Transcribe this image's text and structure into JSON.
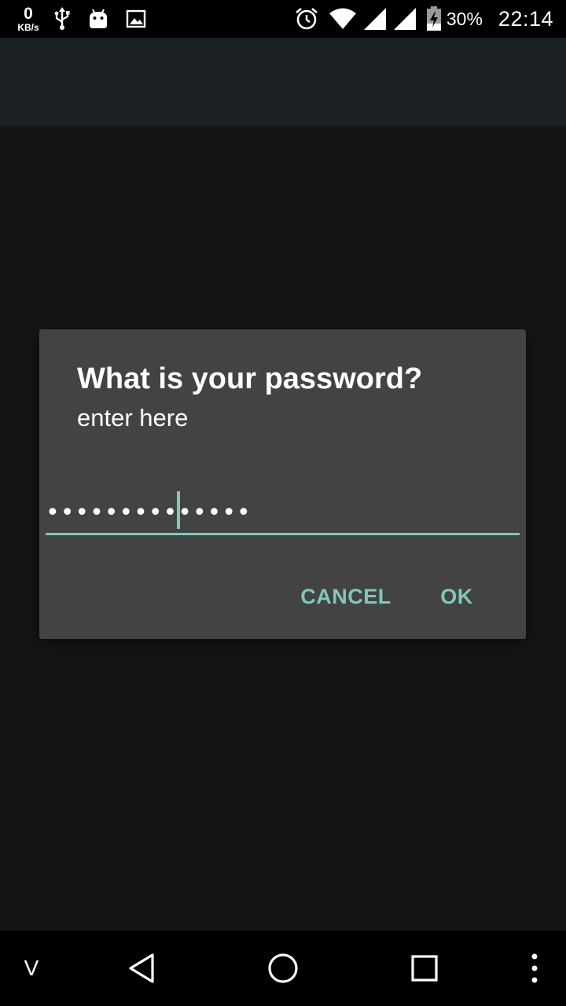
{
  "status_bar": {
    "net_speed_value": "0",
    "net_speed_unit": "KB/s",
    "left_icons": [
      "usb-icon",
      "android-debug-icon",
      "image-icon"
    ],
    "right_icons": [
      "alarm-icon",
      "wifi-icon",
      "cell-signal-icon",
      "cell-signal-icon",
      "battery-charging-icon"
    ],
    "battery_percent": "30%",
    "time": "22:14"
  },
  "dialog": {
    "title": "What is your password?",
    "message": "enter here",
    "password_value": "••••••••••••••",
    "cancel_label": "CANCEL",
    "ok_label": "OK"
  },
  "nav_bar": {
    "extra_label": "V",
    "icons": [
      "back-icon",
      "home-icon",
      "recents-icon",
      "more-icon"
    ]
  },
  "colors": {
    "accent": "#7ec8be",
    "dialog_bg": "#434343",
    "app_bar_bg": "#1b2025",
    "screen_bg": "#151515"
  }
}
